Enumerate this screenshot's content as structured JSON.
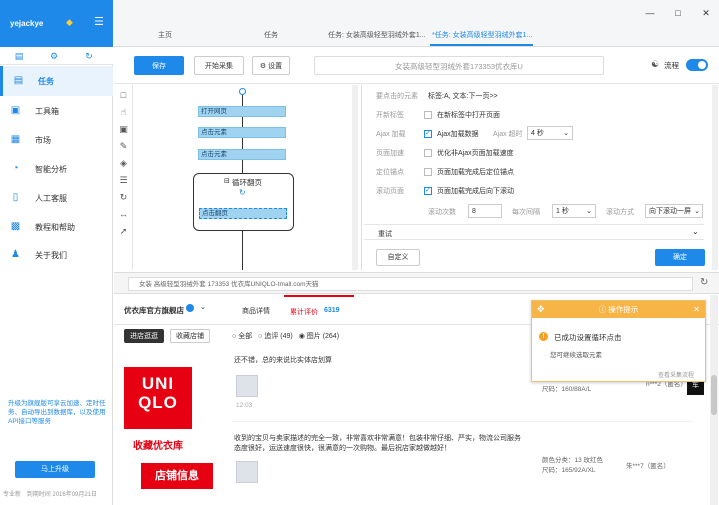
{
  "app": {
    "user": "yejackye"
  },
  "sidebar": {
    "items": [
      {
        "label": "任务",
        "icon": "task-icon"
      },
      {
        "label": "工具箱",
        "icon": "toolbox-icon"
      },
      {
        "label": "市场",
        "icon": "market-icon"
      },
      {
        "label": "智能分析",
        "icon": "analysis-icon"
      },
      {
        "label": "人工客服",
        "icon": "support-icon"
      },
      {
        "label": "教程和帮助",
        "icon": "tutorial-icon"
      },
      {
        "label": "关于我们",
        "icon": "about-icon"
      }
    ],
    "promo": "升级为旗舰版可享云加速、定时任务、自动导出到数据库，以及使用API接口等服务",
    "upgrade_label": "马上升级",
    "edition": "专业新",
    "expire": "到期时间 2016年09月21日"
  },
  "tabs": [
    {
      "label": "主页"
    },
    {
      "label": "任务"
    },
    {
      "label": "任务: 女装高级轻型羽绒外套1..."
    },
    {
      "label": "*任务: 女装高级轻型羽绒外套1..."
    }
  ],
  "toolbar": {
    "save_label": "保存",
    "collect_label": "开始采集",
    "settings_label": "设置",
    "task_title": "女装高级轻型羽绒外套173353优衣库U",
    "flow_label": "流程"
  },
  "flow": {
    "nodes": [
      "打开网页",
      "点击元素",
      "点击元素"
    ],
    "loop_label": "循环翻页",
    "loop_inner": "点击翻页"
  },
  "props": {
    "header": "要点击的元素",
    "header_value": "标签:A, 文本:下一页>>",
    "new_tab_label": "开新标签",
    "new_tab_text": "在新标签中打开页面",
    "ajax_label": "Ajax 加载",
    "ajax_text": "Ajax加载数据",
    "ajax_timeout_label": "Ajax 超时",
    "ajax_timeout_value": "4 秒",
    "page_speed_label": "页面加速",
    "page_speed_text": "优化非Ajax页面加载速度",
    "locate_label": "定位锚点",
    "locate_text": "页面加载完成后定位锚点",
    "scroll_label": "滚动页面",
    "scroll_text": "页面加载完成后向下滚动",
    "scroll_count_label": "滚动次数",
    "scroll_count_value": "8",
    "interval_label": "每次间隔",
    "interval_value": "1 秒",
    "direction_label": "滚动方式",
    "direction_value": "向下滚动一屏",
    "retry_label": "重试",
    "custom_label": "自定义",
    "ok_label": "确定"
  },
  "browser": {
    "url": "女装 高级轻型羽绒外套 173353 优衣库UNIQLO-tmall.com天猫"
  },
  "web": {
    "shop_name": "优衣库官方旗舰店",
    "enter_shop": "进店逛逛",
    "fav_shop": "收藏店铺",
    "tab_details": "商品详情",
    "tab_reviews_label": "累计评价",
    "tab_reviews_count": "6319",
    "filter_all": "全部",
    "filter_append": "追评 (49)",
    "filter_pics": "图片 (264)",
    "brand_top": "UNI",
    "brand_bottom": "QLO",
    "brand_fav": "收藏优衣库",
    "brand_shop": "店铺信息",
    "review1": "还不错，总的来说比实体店划算",
    "review1_date": "12.03",
    "review1_size": "尺码：160/88A/L",
    "review1_user": "n***2（匿名）",
    "review2_line1": "收到的宝贝与卖家描述的完全一致，非常喜欢非常满意！包装非常仔细、严实，物流公司服务",
    "review2_line2": "态度很好，运送速度很快，很满意的一次购物。最后祝店家越做越好！",
    "review2_color": "颜色分类：13 玫红色",
    "review2_size": "尺码：165/92A/XL",
    "review2_user": "朱***7（匿名）",
    "cart_label": "车"
  },
  "popup": {
    "title": "操作提示",
    "message": "已成功设置循环点击",
    "sub": "您可继续选取元素",
    "link": "查看采集流程"
  }
}
